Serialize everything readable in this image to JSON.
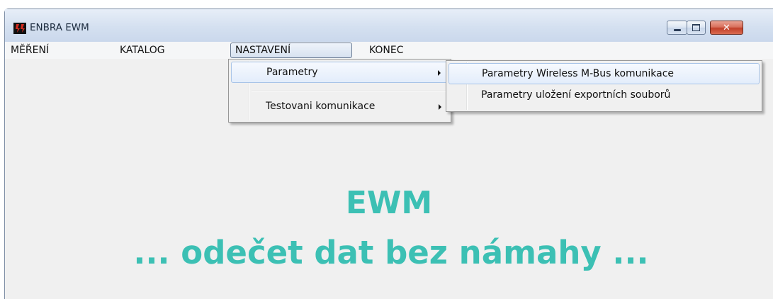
{
  "window": {
    "title": "ENBRA EWM",
    "icon": "enbra-logo-icon",
    "controls": {
      "minimize": "minimize-icon",
      "maximize": "maximize-icon",
      "close": "close-icon"
    },
    "close_glyph": "✕"
  },
  "menu": {
    "items": [
      {
        "label": "MĚŘENÍ"
      },
      {
        "label": "KATALOG"
      },
      {
        "label": "NASTAVENÍ",
        "active": true
      },
      {
        "label": "KONEC"
      }
    ]
  },
  "nastaveni_menu": {
    "items": [
      {
        "label": "Parametry",
        "has_submenu": true,
        "highlighted": true
      },
      {
        "label": "Testovani komunikace",
        "has_submenu": true
      }
    ]
  },
  "parametry_submenu": {
    "items": [
      {
        "label": "Parametry Wireless M-Bus komunikace",
        "highlighted": true
      },
      {
        "label": "Parametry uložení exportních souborů"
      }
    ]
  },
  "hero": {
    "line1": "EWM",
    "line2": "... odečet dat bez námahy ...",
    "color": "#3cc0b4"
  },
  "colors": {
    "titlebar": "#d4e0f0",
    "content_bg": "#f0f0f0",
    "close_button": "#c2402a"
  }
}
